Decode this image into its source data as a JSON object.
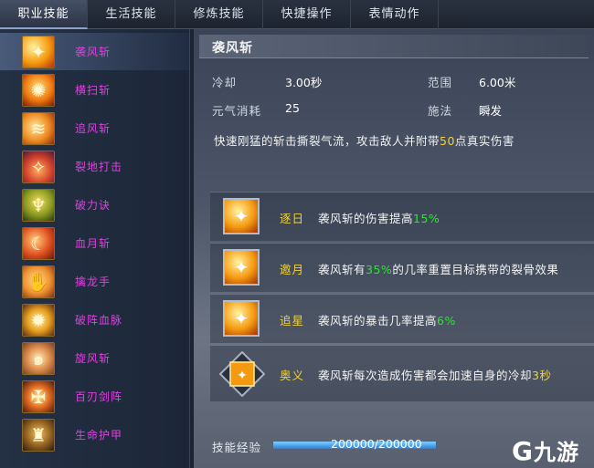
{
  "tabs": [
    {
      "label": "职业技能",
      "active": true
    },
    {
      "label": "生活技能",
      "active": false
    },
    {
      "label": "修炼技能",
      "active": false
    },
    {
      "label": "快捷操作",
      "active": false
    },
    {
      "label": "表情动作",
      "active": false
    }
  ],
  "skills": [
    {
      "label": "袭风斩",
      "icon": "flame-slash-icon",
      "selected": true
    },
    {
      "label": "横扫斩",
      "icon": "flame-burst-icon"
    },
    {
      "label": "追风斩",
      "icon": "wind-slash-icon"
    },
    {
      "label": "裂地打击",
      "icon": "ground-strike-icon"
    },
    {
      "label": "破力诀",
      "icon": "warrior-stance-icon"
    },
    {
      "label": "血月斩",
      "icon": "crescent-icon"
    },
    {
      "label": "擒龙手",
      "icon": "claw-icon"
    },
    {
      "label": "破阵血脉",
      "icon": "power-burst-icon"
    },
    {
      "label": "旋风斩",
      "icon": "whirlwind-icon"
    },
    {
      "label": "百刃剑阵",
      "icon": "sword-ring-icon"
    },
    {
      "label": "生命护甲",
      "icon": "armor-figure-icon"
    }
  ],
  "detail": {
    "title": "袭风斩",
    "cooldown_label": "冷却",
    "cooldown_value": "3.00秒",
    "range_label": "范围",
    "range_value": "6.00米",
    "cost_label": "元气消耗",
    "cost_value": "25",
    "cast_label": "施法",
    "cast_value": "瞬发",
    "desc_pre": "快速刚猛的斩击撕裂气流，攻击敌人并附带",
    "desc_num": "50",
    "desc_post": "点真实伤害"
  },
  "talents": [
    {
      "name": "逐日",
      "pre": "袭风斩的伤害提高",
      "num": "15%",
      "post": ""
    },
    {
      "name": "邀月",
      "pre": "袭风斩有",
      "num": "35%",
      "post": "的几率重置目标携带的裂骨效果"
    },
    {
      "name": "追星",
      "pre": "袭风斩的暴击几率提高",
      "num": "6%",
      "post": ""
    },
    {
      "name": "奥义",
      "pre": "袭风斩每次造成伤害都会加速自身的冷却",
      "num": "3秒",
      "post": ""
    }
  ],
  "exp": {
    "label": "技能经验",
    "value": "200000/200000",
    "progress": 1.0
  },
  "watermark": "九游",
  "colors": {
    "skill_label": "#e040e0",
    "highlight_num": "#34e03a",
    "talent_name": "#f0d23a"
  }
}
